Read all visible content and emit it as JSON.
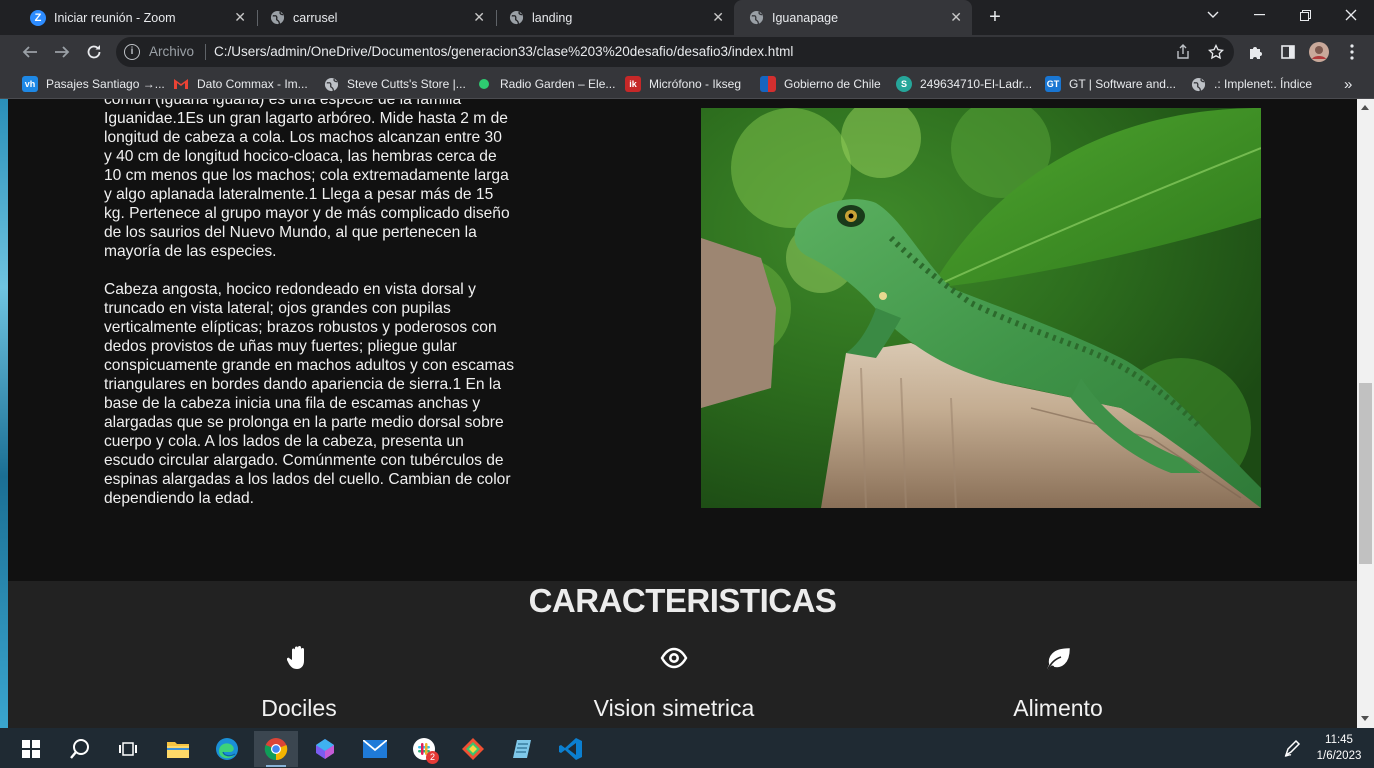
{
  "browser": {
    "tabs": [
      {
        "title": "Iniciar reunión - Zoom",
        "icon": "zoom-icon",
        "color": "#2D8CFF"
      },
      {
        "title": "carrusel",
        "icon": "globe-icon"
      },
      {
        "title": "landing",
        "icon": "globe-icon"
      },
      {
        "title": "Iguanapage",
        "icon": "globe-icon",
        "active": true
      }
    ],
    "new_tab": "+",
    "address": {
      "scheme_label": "Archivo",
      "url": "C:/Users/admin/OneDrive/Documentos/generacion33/clase%203%20desafio/desafio3/index.html"
    },
    "bookmarks": [
      {
        "label": "Pasajes Santiago →...",
        "icon": "vh",
        "color": "#1e88e5"
      },
      {
        "label": "Dato Commax - Im...",
        "icon": "gmail-icon",
        "color": "#ea4335"
      },
      {
        "label": "Steve Cutts's Store |...",
        "icon": "globe-icon",
        "color": "#9aa0a6"
      },
      {
        "label": "Radio Garden – Ele...",
        "icon": "dot-icon",
        "color": "#2ecc71"
      },
      {
        "label": "Micrófono - Ikseg",
        "icon": "ik",
        "color": "#c62828"
      },
      {
        "label": "Gobierno de Chile",
        "icon": "flag-icon",
        "color": "#1565c0"
      },
      {
        "label": "249634710-El-Ladr...",
        "icon": "s",
        "color": "#26a69a"
      },
      {
        "label": "GT | Software and...",
        "icon": "gt",
        "color": "#1976d2"
      },
      {
        "label": ".: Implenet:. Índice",
        "icon": "globe-icon",
        "color": "#9aa0a6"
      }
    ],
    "more_bookmarks": "»"
  },
  "page": {
    "intro_paragraphs": [
      "común (Iguana iguana) es una especie de la familia Iguanidae.1Es un gran lagarto arbóreo. Mide hasta 2 m de longitud de cabeza a cola. Los machos alcanzan entre 30 y 40 cm de longitud hocico-cloaca, las hembras cerca de 10 cm menos que los machos; cola extremadamente larga y algo aplanada lateralmente.1 Llega a pesar más de 15 kg. Pertenece al grupo mayor y de más complicado diseño de los saurios del Nuevo Mundo, al que pertenecen la mayoría de las especies.",
      "Cabeza angosta, hocico redondeado en vista dorsal y truncado en vista lateral; ojos grandes con pupilas verticalmente elípticas; brazos robustos y poderosos con dedos provistos de uñas muy fuertes; pliegue gular conspicuamente grande en machos adultos y con escamas triangulares en bordes dando apariencia de sierra.1 En la base de la cabeza inicia una fila de escamas anchas y alargadas que se prolonga en la parte medio dorsal sobre cuerpo y cola. A los lados de la cabeza, presenta un escudo circular alargado. Comúnmente con tubérculos de espinas alargadas a los lados del cuello. Cambian de color dependiendo la edad."
    ],
    "features_title": "CARACTERISTICAS",
    "features": [
      {
        "icon": "hand-icon",
        "label": "Dociles"
      },
      {
        "icon": "eye-icon",
        "label": "Vision simetrica"
      },
      {
        "icon": "leaf-icon",
        "label": "Alimento"
      }
    ]
  },
  "taskbar": {
    "apps": [
      "start-icon",
      "search-icon",
      "task-view-icon",
      "file-explorer-icon",
      "edge-icon",
      "chrome-icon",
      "copilot-icon",
      "mail-icon",
      "slack-icon",
      "gitkraken-icon",
      "notepad-icon",
      "vscode-icon"
    ],
    "slack_badge": "2",
    "time": "11:45",
    "date": "1/6/2023"
  }
}
